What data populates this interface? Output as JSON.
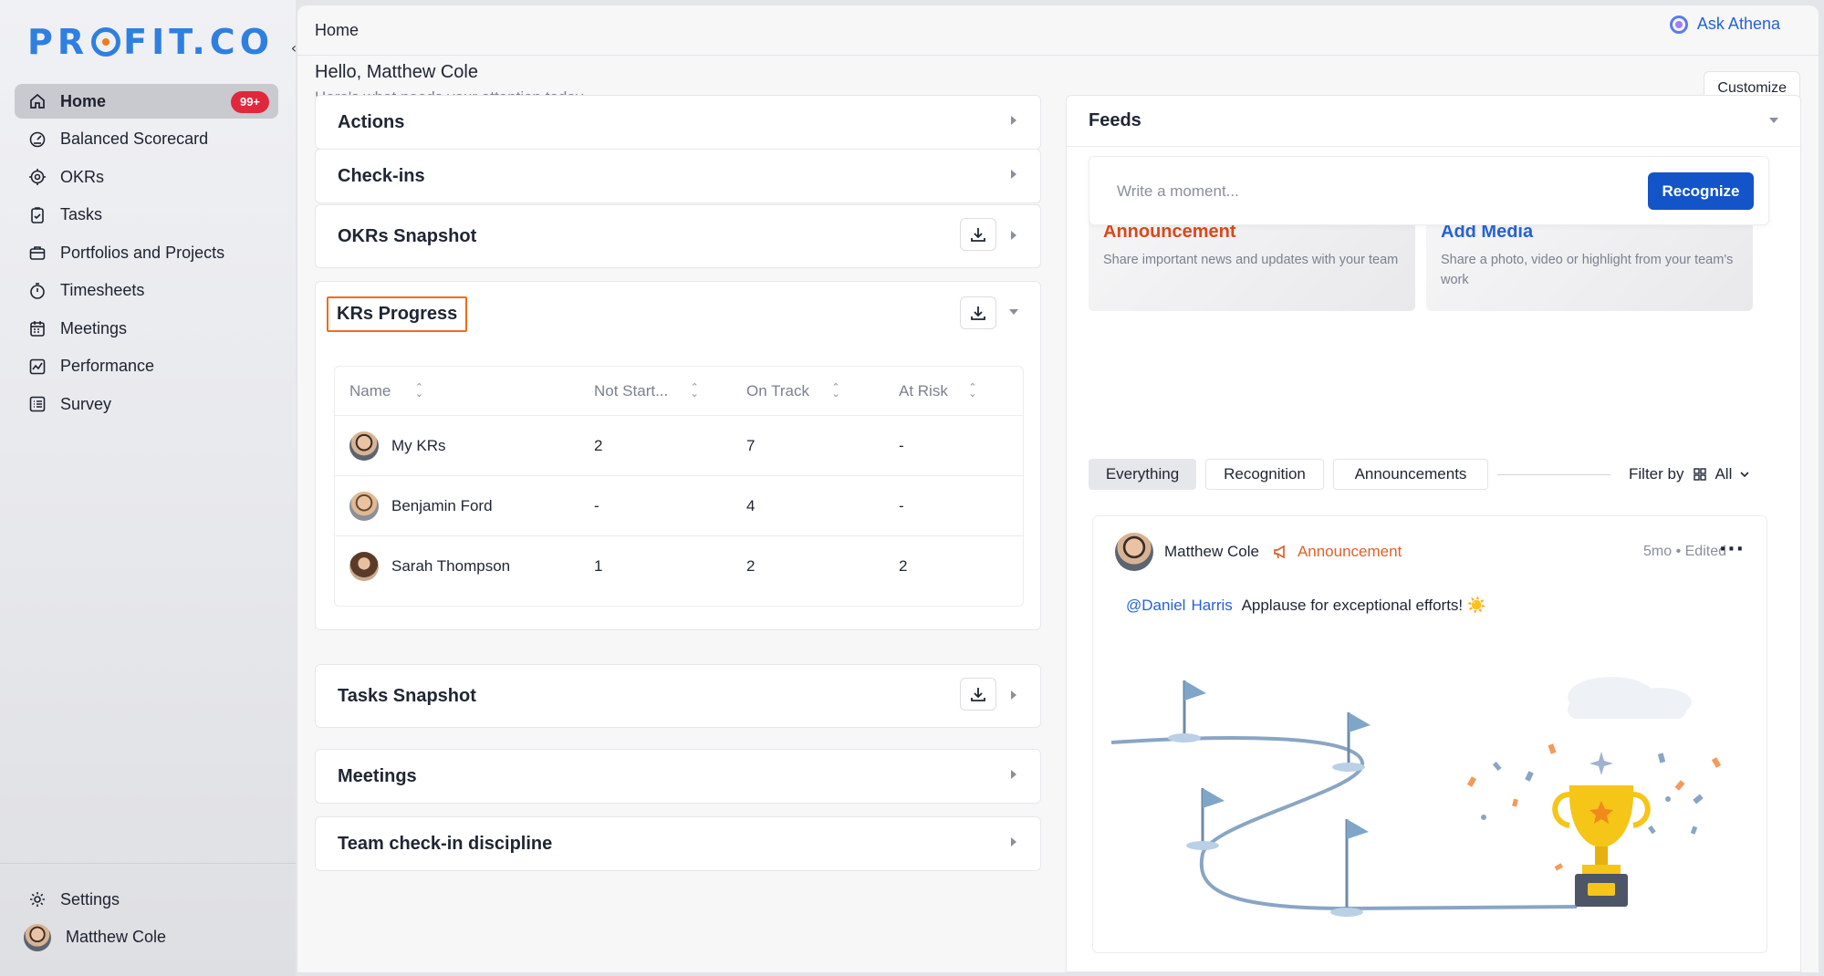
{
  "app": {
    "logo_text": "PROFIT.CO",
    "accent": "#2f7fe0",
    "badge_color": "#e0283c",
    "primary_button": "#1354c8"
  },
  "sidebar": {
    "items": [
      {
        "label": "Home",
        "icon": "home-icon",
        "active": true,
        "badge": "99+"
      },
      {
        "label": "Balanced Scorecard",
        "icon": "gauge-icon"
      },
      {
        "label": "OKRs",
        "icon": "target-icon"
      },
      {
        "label": "Tasks",
        "icon": "clipboard-check-icon"
      },
      {
        "label": "Portfolios and Projects",
        "icon": "briefcase-icon"
      },
      {
        "label": "Timesheets",
        "icon": "stopwatch-icon"
      },
      {
        "label": "Meetings",
        "icon": "calendar-icon"
      },
      {
        "label": "Performance",
        "icon": "chart-line-icon"
      },
      {
        "label": "Survey",
        "icon": "survey-list-icon"
      }
    ],
    "settings_label": "Settings",
    "user_name": "Matthew Cole"
  },
  "topbar": {
    "breadcrumb": "Home",
    "ask_label": "Ask Athena"
  },
  "greeting": {
    "title": "Hello, Matthew Cole",
    "subtitle": "Here's what needs your attention today.",
    "customize_label": "Customize"
  },
  "panels": {
    "actions": "Actions",
    "checkins": "Check-ins",
    "okrs_snapshot": "OKRs Snapshot",
    "krs_progress": "KRs Progress",
    "tasks_snapshot": "Tasks Snapshot",
    "meetings": "Meetings",
    "team_checkin": "Team check-in discipline"
  },
  "kr_table": {
    "columns": [
      "Name",
      "Not Start...",
      "On Track",
      "At Risk"
    ],
    "rows": [
      {
        "name": "My KRs",
        "not_started": "2",
        "on_track": "7",
        "at_risk": "-"
      },
      {
        "name": "Benjamin Ford",
        "not_started": "-",
        "on_track": "4",
        "at_risk": "-"
      },
      {
        "name": "Sarah Thompson",
        "not_started": "1",
        "on_track": "2",
        "at_risk": "2"
      }
    ]
  },
  "feeds": {
    "title": "Feeds",
    "placeholder": "Write a moment...",
    "recognize_label": "Recognize",
    "cards": [
      {
        "title": "Announcement",
        "desc": "Share important news and updates with your team",
        "color": "#d9491c"
      },
      {
        "title": "Add Media",
        "desc": "Share a photo, video or highlight from your team's work",
        "color": "#2562d8"
      }
    ],
    "filters": [
      "Everything",
      "Recognition",
      "Announcements"
    ],
    "filter_by_label": "Filter by",
    "filter_value": "All",
    "post": {
      "author": "Matthew Cole",
      "type": "Announcement",
      "type_color": "#e0622a",
      "meta": "5mo • Edited",
      "mention_first": "@Daniel",
      "mention_last": "Harris",
      "text": "Applause for exceptional efforts! ☀️"
    }
  }
}
